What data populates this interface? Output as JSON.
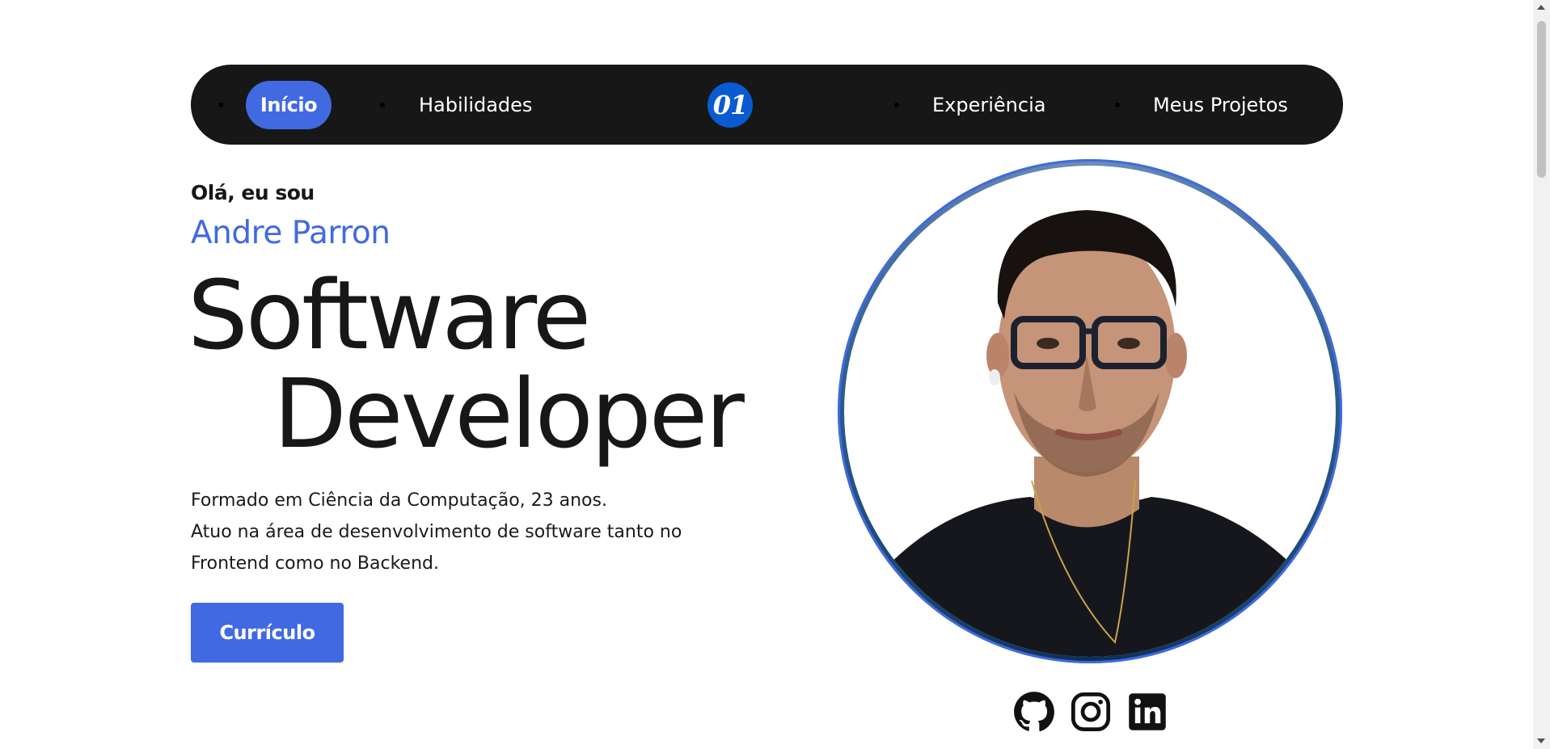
{
  "nav": {
    "items": [
      {
        "label": "Início",
        "active": true
      },
      {
        "label": "Habilidades"
      },
      {
        "label": "Experiência"
      },
      {
        "label": "Meus Projetos"
      }
    ],
    "logo_text": "01"
  },
  "hero": {
    "greeting": "Olá, eu sou",
    "name": "Andre Parron",
    "title_line1": "Software",
    "title_line2": "Developer",
    "description": [
      "Formado em Ciência da Computação, 23 anos.",
      "Atuo na área de desenvolvimento de software tanto no",
      "Frontend como no Backend."
    ],
    "cv_button": "Currículo"
  },
  "social": [
    {
      "icon": "github-icon"
    },
    {
      "icon": "instagram-icon"
    },
    {
      "icon": "linkedin-icon"
    }
  ],
  "colors": {
    "accent": "#4169e1",
    "nav_bg": "#171717",
    "logo_bg": "#0a5bd0",
    "text": "#171717"
  }
}
